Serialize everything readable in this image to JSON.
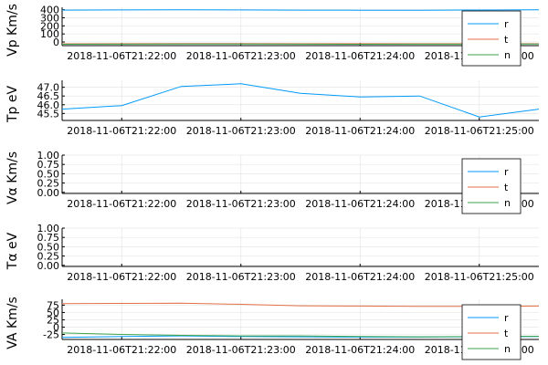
{
  "chart_data": [
    {
      "type": "line",
      "ylabel": "Vp Km/s",
      "x": [
        "2018-11-06T21:21:30",
        "2018-11-06T21:22:00",
        "2018-11-06T21:22:30",
        "2018-11-06T21:23:00",
        "2018-11-06T21:23:30",
        "2018-11-06T21:24:00",
        "2018-11-06T21:24:30",
        "2018-11-06T21:25:00",
        "2018-11-06T21:25:30"
      ],
      "xticks": [
        "2018-11-06T21:22:00",
        "2018-11-06T21:23:00",
        "2018-11-06T21:24:00",
        "2018-11-06T21:25:00"
      ],
      "ylim": [
        -45,
        430
      ],
      "yticks": [
        "0",
        "100",
        "200",
        "300",
        "400"
      ],
      "series": [
        {
          "name": "r",
          "color": "#009af9",
          "values": [
            395,
            397,
            398,
            397,
            395,
            394,
            394,
            396,
            400
          ]
        },
        {
          "name": "t",
          "color": "#e26f46",
          "values": [
            -22,
            -21,
            -20,
            -20,
            -21,
            -21,
            -21,
            -21,
            -21
          ]
        },
        {
          "name": "n",
          "color": "#3da44d",
          "values": [
            -28,
            -27,
            -26,
            -25,
            -27,
            -28,
            -27,
            -26,
            -26
          ]
        }
      ],
      "legend": "bottom-right",
      "grid": true
    },
    {
      "type": "line",
      "ylabel": "Tp eV",
      "x": [
        "2018-11-06T21:21:30",
        "2018-11-06T21:22:00",
        "2018-11-06T21:22:30",
        "2018-11-06T21:23:00",
        "2018-11-06T21:23:30",
        "2018-11-06T21:24:00",
        "2018-11-06T21:24:30",
        "2018-11-06T21:25:00",
        "2018-11-06T21:25:30"
      ],
      "xticks": [
        "2018-11-06T21:22:00",
        "2018-11-06T21:23:00",
        "2018-11-06T21:24:00",
        "2018-11-06T21:25:00"
      ],
      "ylim": [
        45.1,
        47.4
      ],
      "yticks": [
        "45.5",
        "46.0",
        "46.5",
        "47.0"
      ],
      "series": [
        {
          "name": "r",
          "color": "#009af9",
          "values": [
            45.75,
            45.95,
            47.05,
            47.2,
            46.65,
            46.45,
            46.5,
            45.3,
            45.75
          ]
        }
      ],
      "legend": "none",
      "grid": true
    },
    {
      "type": "line",
      "ylabel": "Vα Km/s",
      "x": [
        "2018-11-06T21:21:30",
        "2018-11-06T21:25:30"
      ],
      "xticks": [
        "2018-11-06T21:22:00",
        "2018-11-06T21:23:00",
        "2018-11-06T21:24:00",
        "2018-11-06T21:25:00"
      ],
      "ylim": [
        -0.03,
        1.0
      ],
      "yticks": [
        "0.00",
        "0.25",
        "0.50",
        "0.75",
        "1.00"
      ],
      "series": [
        {
          "name": "r",
          "color": "#009af9",
          "values": []
        },
        {
          "name": "t",
          "color": "#e26f46",
          "values": []
        },
        {
          "name": "n",
          "color": "#3da44d",
          "values": []
        }
      ],
      "legend": "bottom-right",
      "grid": true
    },
    {
      "type": "line",
      "ylabel": "Tα eV",
      "x": [
        "2018-11-06T21:21:30",
        "2018-11-06T21:25:30"
      ],
      "xticks": [
        "2018-11-06T21:22:00",
        "2018-11-06T21:23:00",
        "2018-11-06T21:24:00",
        "2018-11-06T21:25:00"
      ],
      "ylim": [
        -0.03,
        1.0
      ],
      "yticks": [
        "0.00",
        "0.25",
        "0.50",
        "0.75",
        "1.00"
      ],
      "series": [],
      "legend": "none",
      "grid": true
    },
    {
      "type": "line",
      "ylabel": "VA Km/s",
      "x": [
        "2018-11-06T21:21:30",
        "2018-11-06T21:22:00",
        "2018-11-06T21:22:30",
        "2018-11-06T21:23:00",
        "2018-11-06T21:23:30",
        "2018-11-06T21:24:00",
        "2018-11-06T21:24:30",
        "2018-11-06T21:25:00",
        "2018-11-06T21:25:30"
      ],
      "xticks": [
        "2018-11-06T21:22:00",
        "2018-11-06T21:23:00",
        "2018-11-06T21:24:00",
        "2018-11-06T21:25:00"
      ],
      "ylim": [
        -42,
        95
      ],
      "yticks": [
        "-25",
        "0",
        "25",
        "50",
        "75"
      ],
      "series": [
        {
          "name": "r",
          "color": "#009af9",
          "values": [
            -35,
            -32,
            -30,
            -32,
            -33,
            -34,
            -34,
            -33,
            -32
          ]
        },
        {
          "name": "t",
          "color": "#e26f46",
          "values": [
            80,
            81,
            82,
            78,
            73,
            72,
            71,
            71,
            72
          ]
        },
        {
          "name": "n",
          "color": "#3da44d",
          "values": [
            -20,
            -25,
            -28,
            -30,
            -30,
            -32,
            -33,
            -32,
            -31
          ]
        }
      ],
      "legend": "bottom-right",
      "grid": true
    }
  ]
}
